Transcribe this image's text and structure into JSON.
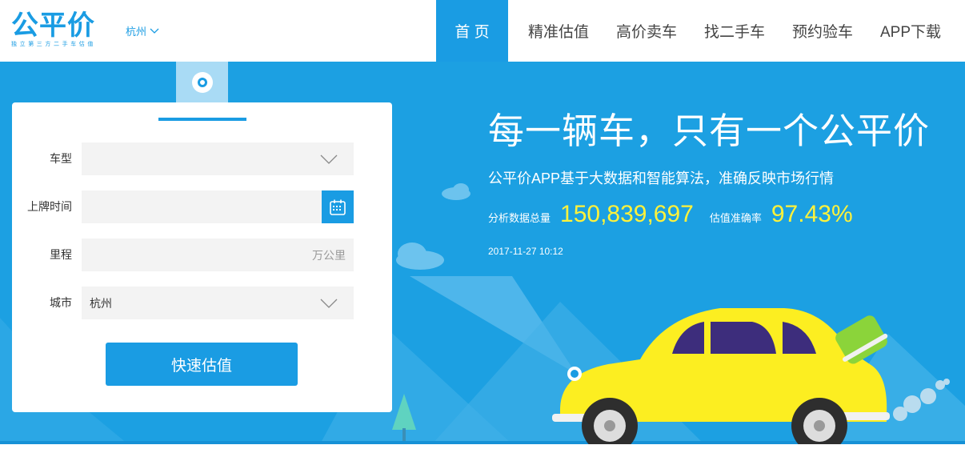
{
  "header": {
    "logo_text": "公平价",
    "logo_tagline": "独立第三方二手车估值",
    "city": "杭州",
    "nav": [
      {
        "label": "首 页",
        "active": true
      },
      {
        "label": "精准估值",
        "active": false
      },
      {
        "label": "高价卖车",
        "active": false
      },
      {
        "label": "找二手车",
        "active": false
      },
      {
        "label": "预约验车",
        "active": false
      },
      {
        "label": "APP下载",
        "active": false
      }
    ]
  },
  "form": {
    "car_model": {
      "label": "车型",
      "value": ""
    },
    "plate_date": {
      "label": "上牌时间",
      "value": ""
    },
    "mileage": {
      "label": "里程",
      "value": "",
      "unit": "万公里"
    },
    "city": {
      "label": "城市",
      "value": "杭州"
    },
    "submit_label": "快速估值"
  },
  "banner": {
    "slogan": "每一辆车，只有一个公平价",
    "sub_slogan": "公平价APP基于大数据和智能算法，准确反映市场行情",
    "stats": {
      "data_label": "分析数据总量",
      "data_value": "150,839,697",
      "accuracy_label": "估值准确率",
      "accuracy_value": "97.43%"
    },
    "update_time": "2017-11-27 10:12"
  },
  "colors": {
    "brand_blue": "#1a9ce3",
    "highlight_yellow": "#fff23a",
    "car_yellow": "#fcee21"
  },
  "icons": [
    "chevron-down-icon",
    "calendar-icon",
    "location-pin-icon",
    "cloud-icon",
    "tree-icon",
    "car-illustration"
  ]
}
